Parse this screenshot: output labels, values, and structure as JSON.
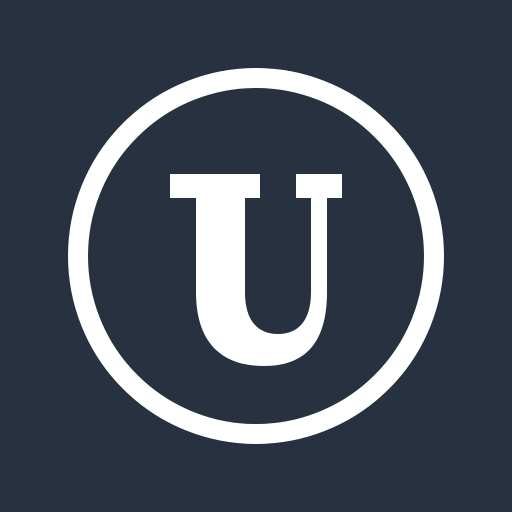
{
  "logo": {
    "letter": "U",
    "background_color": "#28313f",
    "foreground_color": "#ffffff",
    "icon": "circled-letter-u-logo-icon"
  }
}
